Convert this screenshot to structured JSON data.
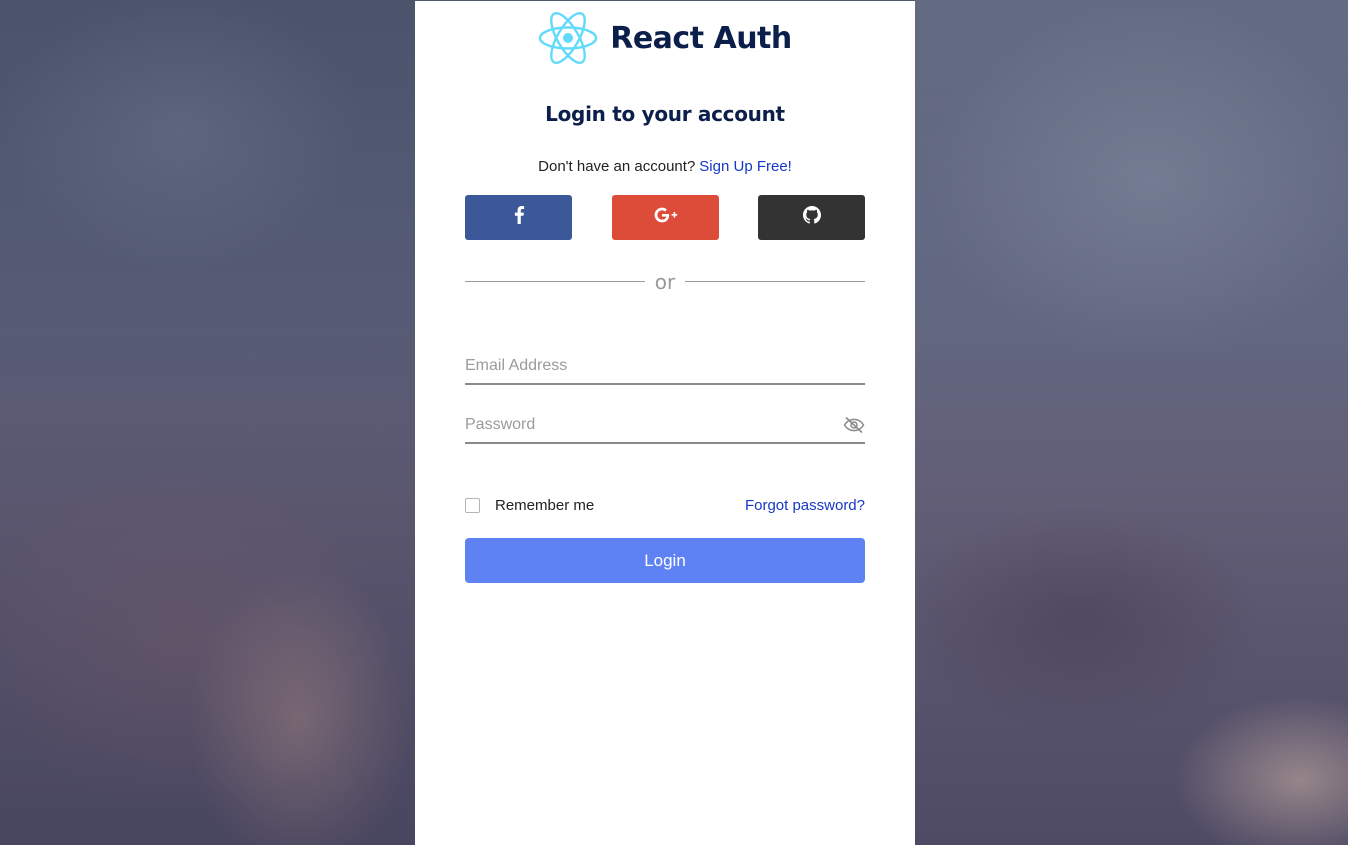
{
  "brand": {
    "title": "React Auth",
    "logo_icon": "react-atom-icon",
    "logo_color": "#61dafb"
  },
  "login": {
    "heading": "Login to your account",
    "signup_prompt": "Don't have an account?",
    "signup_link": "Sign Up Free!",
    "social": [
      {
        "name": "facebook",
        "icon": "facebook-icon",
        "color": "#3b5998"
      },
      {
        "name": "google-plus",
        "icon": "google-plus-icon",
        "color": "#dd4b39"
      },
      {
        "name": "github",
        "icon": "github-icon",
        "color": "#333333"
      }
    ],
    "divider_text": "or",
    "email": {
      "placeholder": "Email Address",
      "value": ""
    },
    "password": {
      "placeholder": "Password",
      "value": "",
      "toggle_icon": "eye-slash-icon"
    },
    "remember_label": "Remember me",
    "remember_checked": false,
    "forgot_link": "Forgot password?",
    "submit_label": "Login",
    "accent_color": "#5e81f4",
    "link_color": "#1537c9"
  }
}
